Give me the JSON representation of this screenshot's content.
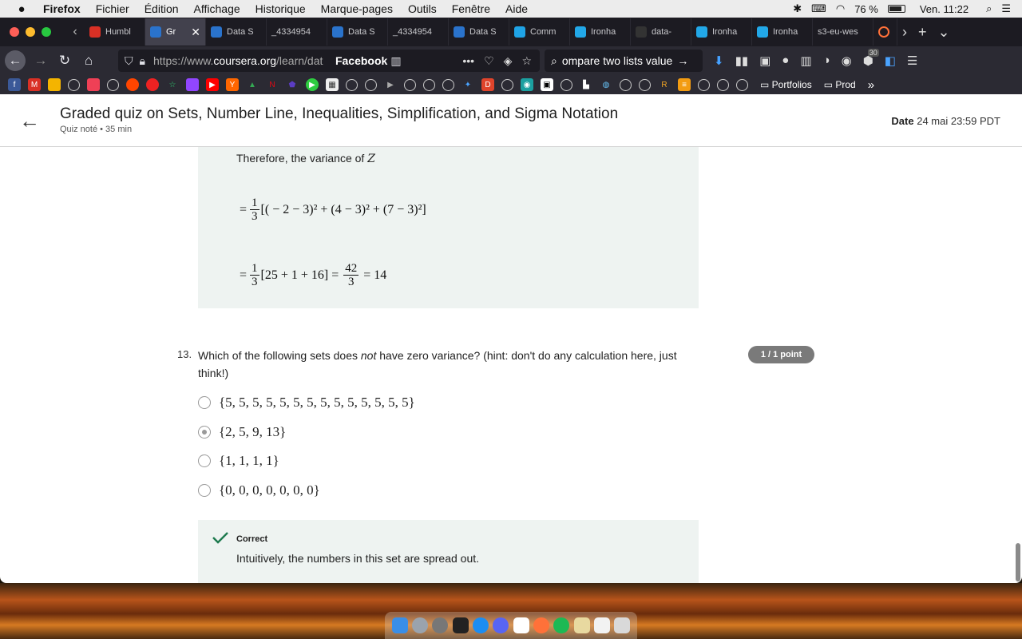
{
  "menubar": {
    "apple": "",
    "items": [
      "Firefox",
      "Fichier",
      "Édition",
      "Affichage",
      "Historique",
      "Marque-pages",
      "Outils",
      "Fenêtre",
      "Aide"
    ],
    "battery": "76 %",
    "clock": "Ven. 11:22"
  },
  "tabs": [
    {
      "label": "Humbl",
      "icon": "gmail-icon",
      "color": "#d93025",
      "active": false
    },
    {
      "label": "Gr",
      "icon": "coursera-icon",
      "color": "#2a73cc",
      "active": true
    },
    {
      "label": "Data S",
      "icon": "coursera-icon",
      "color": "#2a73cc",
      "active": false
    },
    {
      "label": "_4334954",
      "icon": "",
      "color": "",
      "active": false
    },
    {
      "label": "Data S",
      "icon": "coursera-icon",
      "color": "#2a73cc",
      "active": false
    },
    {
      "label": "_4334954",
      "icon": "",
      "color": "",
      "active": false
    },
    {
      "label": "Data S",
      "icon": "coursera-icon",
      "color": "#2a73cc",
      "active": false
    },
    {
      "label": "Comm",
      "icon": "cube-icon",
      "color": "#1fa3e6",
      "active": false
    },
    {
      "label": "Ironha",
      "icon": "ironhack-icon",
      "color": "#22a8e8",
      "active": false
    },
    {
      "label": "data-",
      "icon": "github-icon",
      "color": "#333333",
      "active": false
    },
    {
      "label": "Ironha",
      "icon": "ironhack-icon",
      "color": "#22a8e8",
      "active": false
    },
    {
      "label": "Ironha",
      "icon": "ironhack-icon",
      "color": "#22a8e8",
      "active": false
    },
    {
      "label": "s3-eu-wes",
      "icon": "",
      "color": "",
      "active": false
    }
  ],
  "navbar": {
    "url_prefix": "https://www.",
    "url_domain": "coursera.org",
    "url_path": "/learn/dat",
    "facebook": "Facebook",
    "search_text": "ompare two lists value",
    "badge": "30"
  },
  "bookmarks": {
    "folders": [
      "Portfolios",
      "Prod"
    ]
  },
  "header": {
    "title": "Graded quiz on Sets, Number Line, Inequalities, Simplification, and Sigma Notation",
    "meta": "Quiz noté • 35  min",
    "due_label": "Date",
    "due_value": "24 mai 23:59 PDT"
  },
  "explanation": {
    "intro": "Therefore, the variance of",
    "var": "Z",
    "line1_prefix": "=",
    "line1_frac_num": "1",
    "line1_frac_den": "3",
    "line1_expr": "[( − 2 − 3)² + (4 − 3)² + (7 − 3)²]",
    "line2_prefix": "=",
    "line2_frac_num": "1",
    "line2_frac_den": "3",
    "line2_expr": "[25 + 1 + 16] =",
    "line2_frac2_num": "42",
    "line2_frac2_den": "3",
    "line2_result": "= 14"
  },
  "question": {
    "number": "13.",
    "text_before": "Which of the following sets does ",
    "text_em": "not",
    "text_after": " have zero variance? (hint: don't do any calculation here, just think!)",
    "points": "1 / 1 point",
    "options": [
      {
        "label": "{5, 5, 5, 5, 5, 5, 5, 5, 5, 5, 5, 5, 5, 5}",
        "checked": false
      },
      {
        "label": "{2, 5, 9, 13}",
        "checked": true
      },
      {
        "label": "{1, 1, 1, 1}",
        "checked": false
      },
      {
        "label": "{0, 0, 0, 0, 0, 0, 0}",
        "checked": false
      }
    ]
  },
  "feedback": {
    "title": "Correct",
    "text": "Intuitively, the numbers in this set are spread out."
  }
}
